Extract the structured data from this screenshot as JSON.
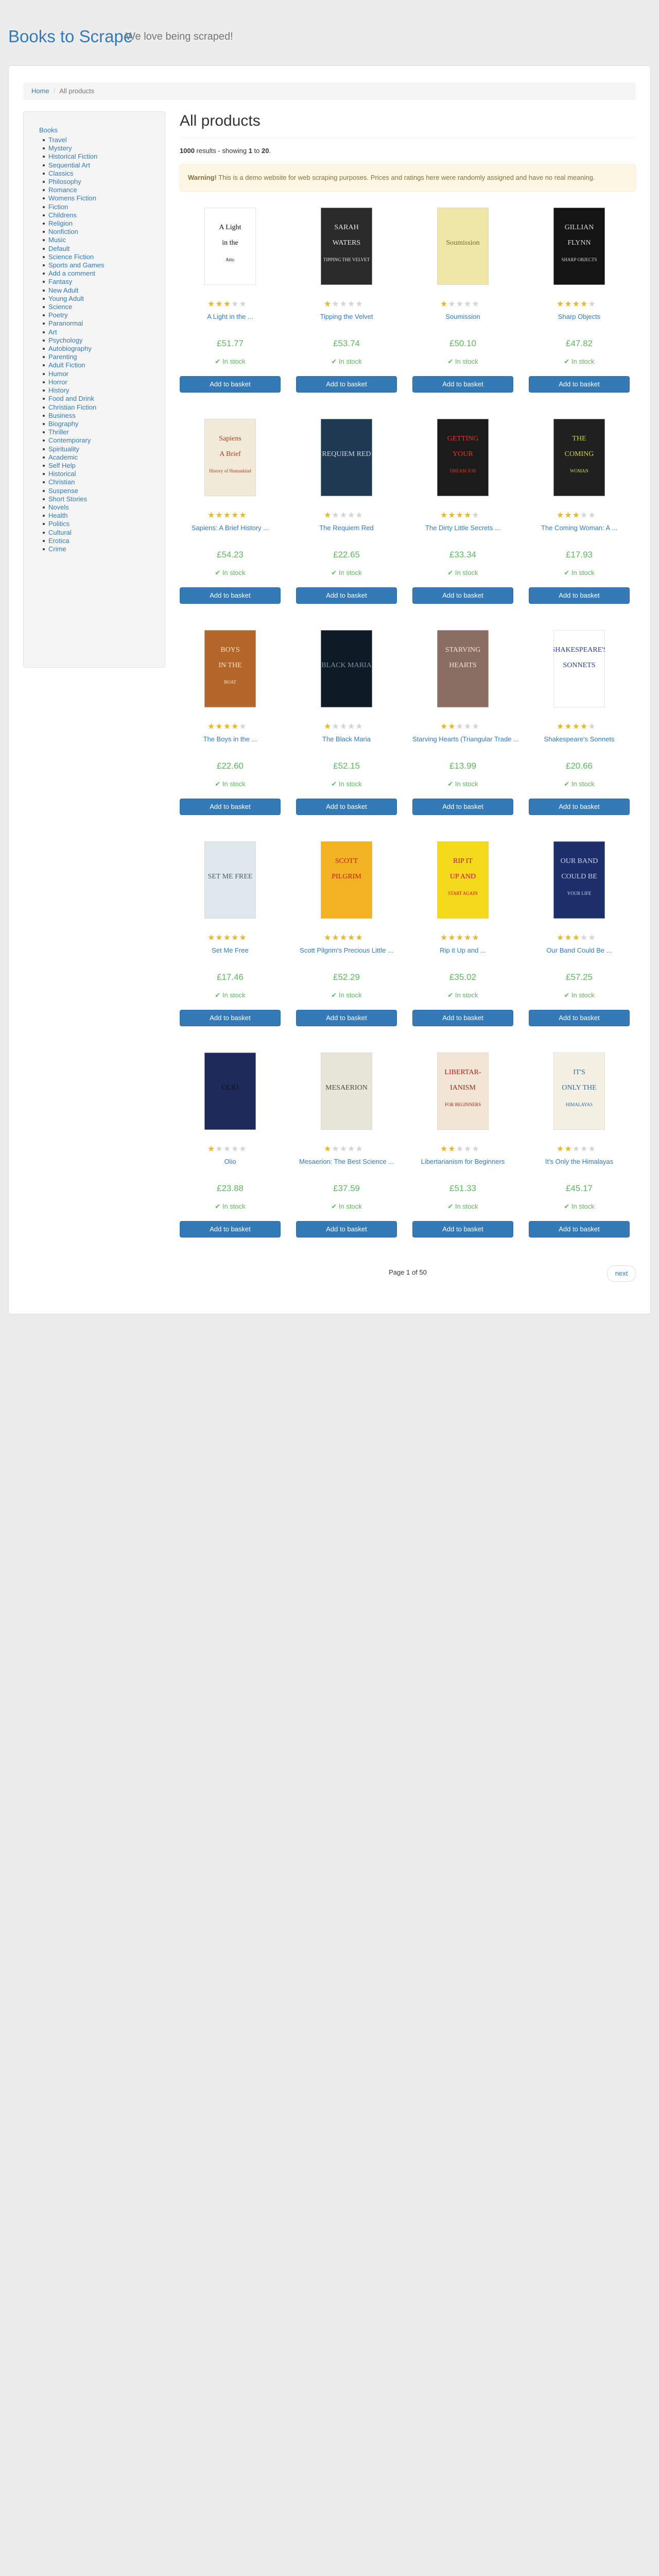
{
  "header": {
    "brand": "Books to Scrape",
    "tagline": "We love being scraped!"
  },
  "breadcrumb": {
    "home": "Home",
    "separator": "/",
    "current": "All products"
  },
  "sidebar": {
    "root": "Books",
    "categories": [
      "Travel",
      "Mystery",
      "Historical Fiction",
      "Sequential Art",
      "Classics",
      "Philosophy",
      "Romance",
      "Womens Fiction",
      "Fiction",
      "Childrens",
      "Religion",
      "Nonfiction",
      "Music",
      "Default",
      "Science Fiction",
      "Sports and Games",
      "Add a comment",
      "Fantasy",
      "New Adult",
      "Young Adult",
      "Science",
      "Poetry",
      "Paranormal",
      "Art",
      "Psychology",
      "Autobiography",
      "Parenting",
      "Adult Fiction",
      "Humor",
      "Horror",
      "History",
      "Food and Drink",
      "Christian Fiction",
      "Business",
      "Biography",
      "Thriller",
      "Contemporary",
      "Spirituality",
      "Academic",
      "Self Help",
      "Historical",
      "Christian",
      "Suspense",
      "Short Stories",
      "Novels",
      "Health",
      "Politics",
      "Cultural",
      "Erotica",
      "Crime"
    ]
  },
  "main": {
    "heading": "All products",
    "results": {
      "count": "1000",
      "mid": " results - showing ",
      "from": "1",
      "to_word": " to ",
      "to": "20",
      "end": "."
    },
    "warning": {
      "label": "Warning!",
      "text": " This is a demo website for web scraping purposes. Prices and ratings here were randomly assigned and have no real meaning."
    },
    "stock_label": "In stock",
    "basket_label": "Add to basket",
    "products": [
      {
        "title": "A Light in the ...",
        "price": "£51.77",
        "rating": 3,
        "cover": {
          "bg": "#ffffff",
          "fg": "#111111",
          "lines": [
            "A Light",
            "in the",
            "Attic"
          ]
        }
      },
      {
        "title": "Tipping the Velvet",
        "price": "£53.74",
        "rating": 1,
        "cover": {
          "bg": "#2a2a2a",
          "fg": "#e8e8e8",
          "lines": [
            "SARAH",
            "WATERS",
            "TIPPING THE VELVET"
          ]
        }
      },
      {
        "title": "Soumission",
        "price": "£50.10",
        "rating": 1,
        "cover": {
          "bg": "#efe7a8",
          "fg": "#7a6a2a",
          "lines": [
            "",
            "Soumission",
            ""
          ]
        }
      },
      {
        "title": "Sharp Objects",
        "price": "£47.82",
        "rating": 4,
        "cover": {
          "bg": "#141414",
          "fg": "#d8d8d8",
          "lines": [
            "GILLIAN",
            "FLYNN",
            "SHARP OBJECTS"
          ]
        }
      },
      {
        "title": "Sapiens: A Brief History ...",
        "price": "£54.23",
        "rating": 5,
        "cover": {
          "bg": "#f2ead8",
          "fg": "#a0431e",
          "lines": [
            "Sapiens",
            "A Brief",
            "History of Humankind"
          ]
        }
      },
      {
        "title": "The Requiem Red",
        "price": "£22.65",
        "rating": 1,
        "cover": {
          "bg": "#1f3a52",
          "fg": "#c9d7e4",
          "lines": [
            "",
            "REQUIEM RED",
            ""
          ]
        }
      },
      {
        "title": "The Dirty Little Secrets ...",
        "price": "£33.34",
        "rating": 4,
        "cover": {
          "bg": "#1b1b1b",
          "fg": "#e03a2a",
          "lines": [
            "GETTING",
            "YOUR",
            "DREAM JOB"
          ]
        }
      },
      {
        "title": "The Coming Woman: A ...",
        "price": "£17.93",
        "rating": 3,
        "cover": {
          "bg": "#202020",
          "fg": "#d6d15a",
          "lines": [
            "THE",
            "COMING",
            "WOMAN"
          ]
        }
      },
      {
        "title": "The Boys in the ...",
        "price": "£22.60",
        "rating": 4,
        "cover": {
          "bg": "#b5662a",
          "fg": "#fbe4c8",
          "lines": [
            "BOYS",
            "IN THE",
            "BOAT"
          ]
        }
      },
      {
        "title": "The Black Maria",
        "price": "£52.15",
        "rating": 1,
        "cover": {
          "bg": "#0e1a26",
          "fg": "#7d93a8",
          "lines": [
            "",
            "BLACK MARIA",
            ""
          ]
        }
      },
      {
        "title": "Starving Hearts (Triangular Trade ...",
        "price": "£13.99",
        "rating": 2,
        "cover": {
          "bg": "#8a6e62",
          "fg": "#f1e2d8",
          "lines": [
            "STARVING",
            "HEARTS",
            ""
          ]
        }
      },
      {
        "title": "Shakespeare's Sonnets",
        "price": "£20.66",
        "rating": 4,
        "cover": {
          "bg": "#ffffff",
          "fg": "#2a3f88",
          "lines": [
            "SHAKESPEARE'S",
            "SONNETS",
            ""
          ]
        }
      },
      {
        "title": "Set Me Free",
        "price": "£17.46",
        "rating": 5,
        "cover": {
          "bg": "#dfe8ec",
          "fg": "#4a5a66",
          "lines": [
            "",
            "SET ME FREE",
            ""
          ]
        }
      },
      {
        "title": "Scott Pilgrim's Precious Little ...",
        "price": "£52.29",
        "rating": 5,
        "cover": {
          "bg": "#f3b221",
          "fg": "#c42020",
          "lines": [
            "SCOTT",
            "PILGRIM",
            ""
          ]
        }
      },
      {
        "title": "Rip it Up and ...",
        "price": "£35.02",
        "rating": 5,
        "cover": {
          "bg": "#f4d91c",
          "fg": "#c8161d",
          "lines": [
            "RIP IT",
            "UP AND",
            "START AGAIN"
          ]
        }
      },
      {
        "title": "Our Band Could Be ...",
        "price": "£57.25",
        "rating": 3,
        "cover": {
          "bg": "#1d2f6a",
          "fg": "#c9d2ee",
          "lines": [
            "OUR BAND",
            "COULD BE",
            "YOUR LIFE"
          ]
        }
      },
      {
        "title": "Olio",
        "price": "£23.88",
        "rating": 1,
        "cover": {
          "bg": "#1d2a5a",
          "fg": "#111111",
          "lines": [
            "",
            "OLIO",
            ""
          ]
        }
      },
      {
        "title": "Mesaerion: The Best Science ...",
        "price": "£37.59",
        "rating": 1,
        "cover": {
          "bg": "#e8e6d8",
          "fg": "#4d4a36",
          "lines": [
            "",
            "MESAERION",
            ""
          ]
        }
      },
      {
        "title": "Libertarianism for Beginners",
        "price": "£51.33",
        "rating": 2,
        "cover": {
          "bg": "#f1e6d4",
          "fg": "#9b1e1e",
          "lines": [
            "LIBERTAR-",
            "IANISM",
            "FOR BEGINNERS"
          ]
        }
      },
      {
        "title": "It's Only the Himalayas",
        "price": "£45.17",
        "rating": 2,
        "cover": {
          "bg": "#f4f0e4",
          "fg": "#2d6a9f",
          "lines": [
            "IT'S",
            "ONLY THE",
            "HIMALAYAS"
          ]
        }
      }
    ]
  },
  "pager": {
    "current": "Page 1 of 50",
    "next": "next"
  },
  "colors": {
    "link": "#337ab7",
    "price": "#5cb85c",
    "star": "#e6b82e",
    "button": "#337ab7"
  }
}
